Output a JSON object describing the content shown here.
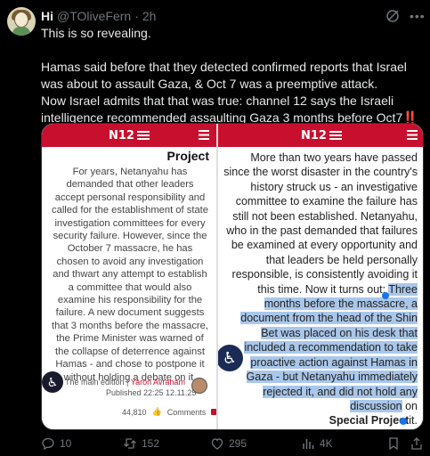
{
  "post": {
    "display_name": "Hi",
    "handle": "@TOliveFern",
    "time": "2h",
    "text_line1": "This is so revealing.",
    "text_para2": "Hamas said before that they detected confirmed reports that Israel was about to assault Gaza, & Oct 7 was a preemptive attack.",
    "text_para3": "Now Israel admits that that was true: channel 12 says the Israeli intelligence recommended assaulting Gaza 3 months before Oct7",
    "text_emoji": "‼️"
  },
  "media": {
    "logo_text": "N12",
    "left": {
      "heading": "Project",
      "body": "For years, Netanyahu has demanded that other leaders accept personal responsibility and called for the establishment of state investigation committees for every security failure. However, since the October 7 massacre, he has chosen to avoid any investigation and thwart any attempt to establish a committee that would also examine his responsibility for the failure. A new document suggests that 3 months before the massacre, the Prime Minister was warned of the collapse of deterrence against Hamas - and chose to postpone it without holding a debate on it.",
      "edition": "The main edition |",
      "author": "Yaron Avraham",
      "published": "Published 22:25 12.11.25",
      "views": "44,810",
      "comments": "Comments"
    },
    "right": {
      "body_plain": "More than two years have passed since the worst disaster in the country's history struck us - an investigative committee to examine the failure has still not been established. Netanyahu, who in the past demanded that failures be examined at every opportunity and that leaders be held personally responsible, is consistently avoiding it this time. Now it turns out: ",
      "body_highlight": "Three months before the massacre, a document from the head of the Shin Bet was placed on his desk that included a recommendation to take proactive action against Hamas in Gaza - but Netanyahu immediately rejected it, and did not hold any discussion",
      "body_tail": " on",
      "footer": "Special Project",
      "footer_tail": "it."
    }
  },
  "actions": {
    "replies": "10",
    "reposts": "152",
    "likes": "295",
    "views": "4K"
  },
  "colors": {
    "accent_red": "#c8102e",
    "highlight": "#a9c7ea",
    "muted": "#71767b"
  }
}
